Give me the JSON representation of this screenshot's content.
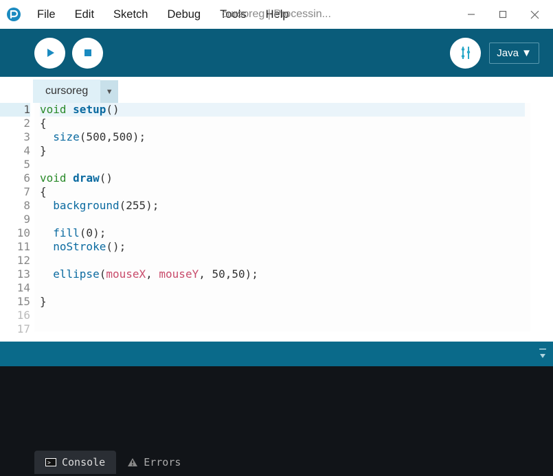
{
  "window": {
    "title": "cursoreg | Processin..."
  },
  "menu": {
    "file": "File",
    "edit": "Edit",
    "sketch": "Sketch",
    "debug": "Debug",
    "tools": "Tools",
    "help": "Help"
  },
  "toolbar": {
    "mode": "Java ▼"
  },
  "tabs": {
    "active": "cursoreg",
    "dropdown": "▼"
  },
  "code": {
    "lines": [
      {
        "n": "1",
        "segs": [
          {
            "t": "void ",
            "c": "kw"
          },
          {
            "t": "setup",
            "c": "fn"
          },
          {
            "t": "()",
            "c": ""
          }
        ],
        "current": true
      },
      {
        "n": "2",
        "segs": [
          {
            "t": "{",
            "c": ""
          }
        ]
      },
      {
        "n": "3",
        "segs": [
          {
            "t": "  ",
            "c": ""
          },
          {
            "t": "size",
            "c": "call"
          },
          {
            "t": "(500,500);",
            "c": ""
          }
        ]
      },
      {
        "n": "4",
        "segs": [
          {
            "t": "}",
            "c": ""
          }
        ]
      },
      {
        "n": "5",
        "segs": []
      },
      {
        "n": "6",
        "segs": [
          {
            "t": "void ",
            "c": "kw"
          },
          {
            "t": "draw",
            "c": "fn"
          },
          {
            "t": "()",
            "c": ""
          }
        ]
      },
      {
        "n": "7",
        "segs": [
          {
            "t": "{",
            "c": ""
          }
        ]
      },
      {
        "n": "8",
        "segs": [
          {
            "t": "  ",
            "c": ""
          },
          {
            "t": "background",
            "c": "call"
          },
          {
            "t": "(255);",
            "c": ""
          }
        ]
      },
      {
        "n": "9",
        "segs": []
      },
      {
        "n": "10",
        "segs": [
          {
            "t": "  ",
            "c": ""
          },
          {
            "t": "fill",
            "c": "call"
          },
          {
            "t": "(0);",
            "c": ""
          }
        ]
      },
      {
        "n": "11",
        "segs": [
          {
            "t": "  ",
            "c": ""
          },
          {
            "t": "noStroke",
            "c": "call"
          },
          {
            "t": "();",
            "c": ""
          }
        ]
      },
      {
        "n": "12",
        "segs": []
      },
      {
        "n": "13",
        "segs": [
          {
            "t": "  ",
            "c": ""
          },
          {
            "t": "ellipse",
            "c": "call"
          },
          {
            "t": "(",
            "c": ""
          },
          {
            "t": "mouseX",
            "c": "var"
          },
          {
            "t": ", ",
            "c": ""
          },
          {
            "t": "mouseY",
            "c": "var"
          },
          {
            "t": ", 50,50);",
            "c": ""
          }
        ]
      },
      {
        "n": "14",
        "segs": []
      },
      {
        "n": "15",
        "segs": [
          {
            "t": "}",
            "c": ""
          }
        ]
      },
      {
        "n": "16",
        "segs": [],
        "dim": true
      },
      {
        "n": "17",
        "segs": [],
        "dim": true
      }
    ]
  },
  "bottom": {
    "console": "Console",
    "errors": "Errors"
  }
}
